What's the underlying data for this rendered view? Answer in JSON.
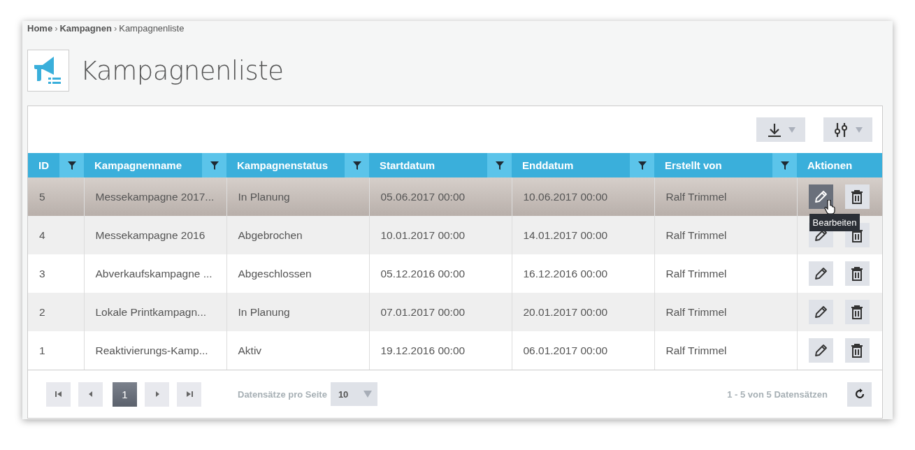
{
  "breadcrumb": [
    {
      "label": "Home",
      "current": false
    },
    {
      "separator": "›"
    },
    {
      "label": "Kampagnen",
      "current": false
    },
    {
      "separator": "›"
    },
    {
      "label": "Kampagnenliste",
      "current": true
    }
  ],
  "page_title": "Kampagnenliste",
  "toolbar": [
    {
      "kind": "export"
    },
    {
      "kind": "columns"
    }
  ],
  "table": {
    "columns": [
      {
        "label": "ID",
        "filter": true
      },
      {
        "label": "Kampagnenname",
        "filter": true
      },
      {
        "label": "Kampagnenstatus",
        "filter": true
      },
      {
        "label": "Startdatum",
        "filter": true
      },
      {
        "label": "Enddatum",
        "filter": true
      },
      {
        "label": "Erstellt von",
        "filter": true
      },
      {
        "label": "Aktionen",
        "filter": false
      }
    ],
    "rows": [
      {
        "selected": true,
        "cells": [
          "5",
          "Messekampagne 2017...",
          "In Planung",
          "05.06.2017 00:00",
          "10.06.2017 00:00",
          "Ralf Trimmel"
        ],
        "tooltip": "Bearbeiten"
      },
      {
        "selected": false,
        "cells": [
          "4",
          "Messekampagne 2016",
          "Abgebrochen",
          "10.01.2017 00:00",
          "14.01.2017 00:00",
          "Ralf Trimmel"
        ]
      },
      {
        "selected": false,
        "cells": [
          "3",
          "Abverkaufskampagne ...",
          "Abgeschlossen",
          "05.12.2016 00:00",
          "16.12.2016 00:00",
          "Ralf Trimmel"
        ]
      },
      {
        "selected": false,
        "cells": [
          "2",
          "Lokale Printkampagn...",
          "In Planung",
          "07.01.2017 00:00",
          "20.01.2017 00:00",
          "Ralf Trimmel"
        ]
      },
      {
        "selected": false,
        "cells": [
          "1",
          "Reaktivierungs-Kamp...",
          "Aktiv",
          "19.12.2016 00:00",
          "06.01.2017 00:00",
          "Ralf Trimmel"
        ]
      }
    ]
  },
  "pager": {
    "pages": [
      {
        "label": "1",
        "selected": true
      }
    ],
    "page_size_label": "Datensätze pro Seite",
    "page_size": "10",
    "summary": "1 - 5 von 5 Datensätzen"
  }
}
